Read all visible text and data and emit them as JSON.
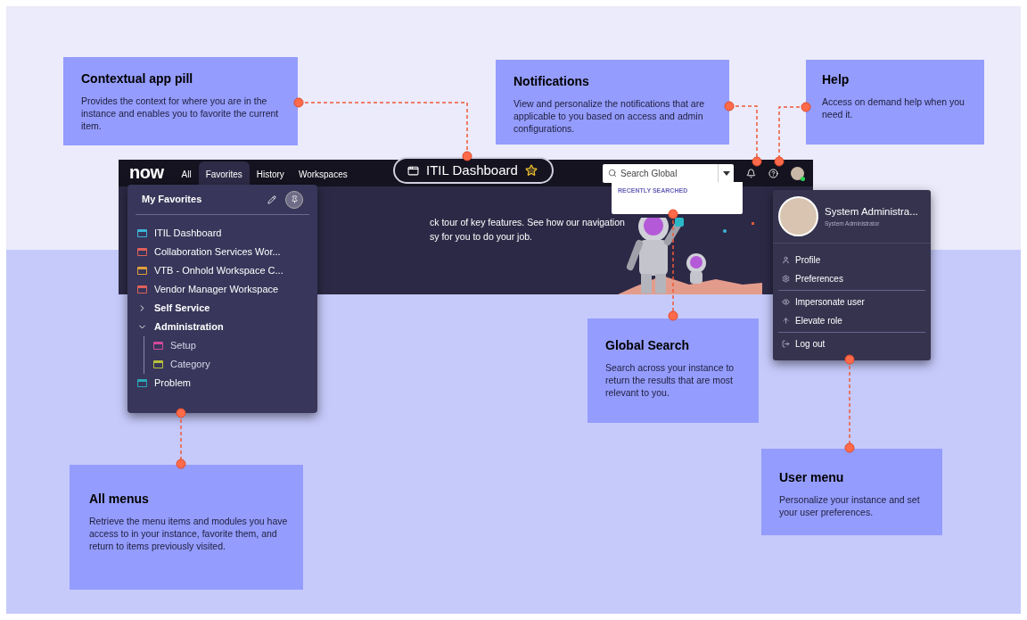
{
  "callouts": [
    {
      "title": "Contextual app pill",
      "text": "Provides the context for where you are in the instance and enables you to favorite the current item."
    },
    {
      "title": "Notifications",
      "text": "View and personalize the notifications that are applicable to you based on access and admin configurations."
    },
    {
      "title": "Help",
      "text": "Access on demand help when you need it."
    },
    {
      "title": "Global Search",
      "text": "Search across your instance to return the results that are most relevant to you."
    },
    {
      "title": "All menus",
      "text": "Retrieve the menu items and modules you have access to in your instance, favorite them, and return to items previously visited."
    },
    {
      "title": "User menu",
      "text": "Personalize your instance and set your user preferences."
    }
  ],
  "navbar": {
    "logo": "now",
    "tabs": [
      {
        "label": "All",
        "selected": false
      },
      {
        "label": "Favorites",
        "selected": true
      },
      {
        "label": "History",
        "selected": false
      },
      {
        "label": "Workspaces",
        "selected": false
      }
    ],
    "search": {
      "placeholder": "Search Global",
      "recent_label": "RECENTLY SEARCHED"
    }
  },
  "context_pill": {
    "title": "ITIL Dashboard",
    "favorited": true
  },
  "banner": {
    "lines": [
      "ck tour of key features. See how our navigation",
      "sy for you to do your job."
    ]
  },
  "favorites_menu": {
    "title": "My Favorites",
    "pinned": true,
    "items": [
      {
        "kind": "link",
        "label": "ITIL Dashboard",
        "color": "#3bb6d6"
      },
      {
        "kind": "link",
        "label": "Collaboration Services Wor...",
        "color": "#e0605a"
      },
      {
        "kind": "link",
        "label": "VTB - Onhold Workspace C...",
        "color": "#e0a03a"
      },
      {
        "kind": "link",
        "label": "Vendor Manager Workspace",
        "color": "#e0605a"
      },
      {
        "kind": "group",
        "label": "Self Service",
        "expanded": false
      },
      {
        "kind": "group",
        "label": "Administration",
        "expanded": true,
        "children": [
          {
            "kind": "link",
            "label": "Setup",
            "color": "#d44a9a"
          },
          {
            "kind": "link",
            "label": "Category",
            "color": "#b8c23a"
          }
        ]
      },
      {
        "kind": "link",
        "label": "Problem",
        "color": "#2aa8b8"
      }
    ]
  },
  "user_menu": {
    "name": "System Administra...",
    "role": "System Administrator",
    "online": true,
    "sections": [
      [
        "Profile",
        "Preferences"
      ],
      [
        "Impersonate user",
        "Elevate role"
      ],
      [
        "Log out"
      ]
    ]
  }
}
